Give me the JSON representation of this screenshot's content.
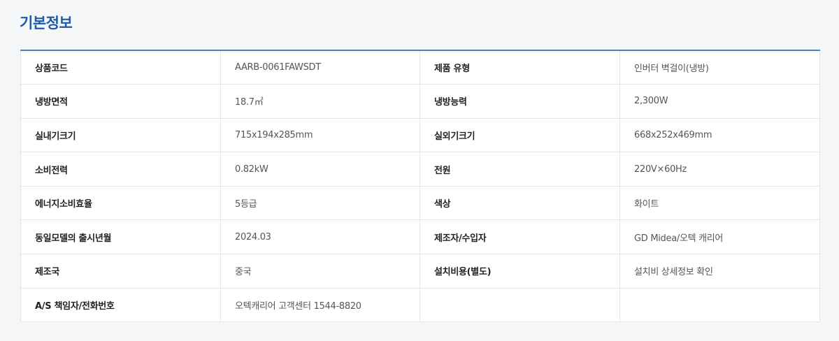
{
  "section": {
    "title": "기본정보"
  },
  "rows": [
    {
      "label1": "상품코드",
      "value1": "AARB-0061FAWSDT",
      "label2": "제품 유형",
      "value2": "인버터 벽걸이(냉방)"
    },
    {
      "label1": "냉방면적",
      "value1": "18.7㎡",
      "label2": "냉방능력",
      "value2": "2,300W"
    },
    {
      "label1": "실내기크기",
      "value1": "715x194x285mm",
      "label2": "실외기크기",
      "value2": "668x252x469mm"
    },
    {
      "label1": "소비전력",
      "value1": "0.82kW",
      "label2": "전원",
      "value2": "220V×60Hz"
    },
    {
      "label1": "에너지소비효율",
      "value1": "5등급",
      "label2": "색상",
      "value2": "화이트"
    },
    {
      "label1": "동일모델의 출시년월",
      "value1": "2024.03",
      "label2": "제조자/수입자",
      "value2": "GD Midea/오텍 캐리어"
    },
    {
      "label1": "제조국",
      "value1": "중국",
      "label2": "설치비용(별도)",
      "value2": "설치비 상세정보 확인"
    },
    {
      "label1": "A/S 책임자/전화번호",
      "value1": "오텍캐리어 고객센터 1544-8820",
      "label2": "",
      "value2": ""
    }
  ],
  "colors": {
    "title": "#1e5aa8",
    "table_top_border": "#4a7fc1"
  }
}
